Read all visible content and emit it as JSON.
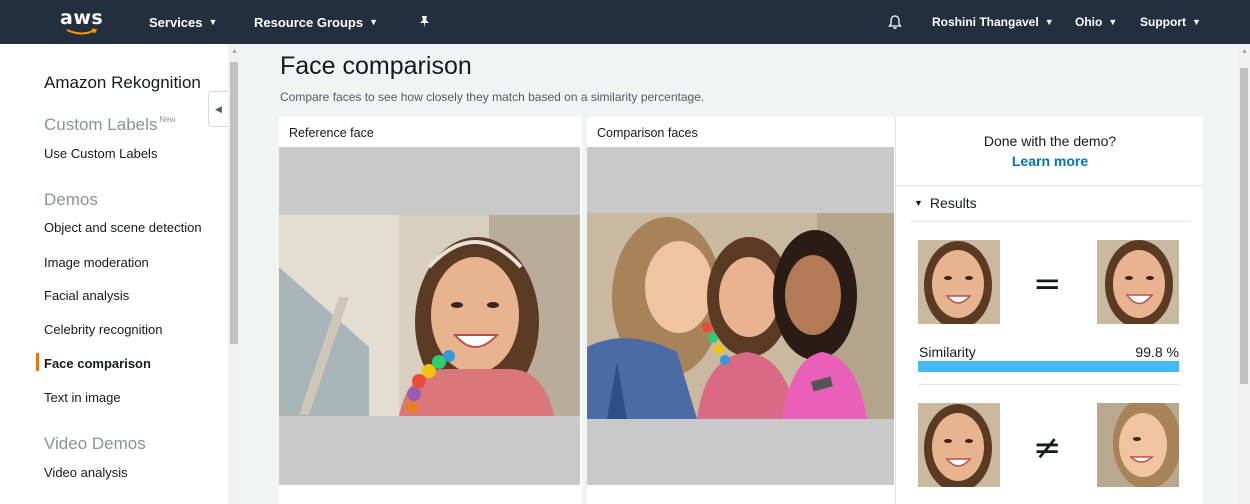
{
  "nav": {
    "logo": "aws",
    "services": "Services",
    "resource_groups": "Resource Groups",
    "user": "Roshini Thangavel",
    "region": "Ohio",
    "support": "Support"
  },
  "sidebar": {
    "title": "Amazon Rekognition",
    "custom_labels_heading": "Custom Labels",
    "custom_labels_badge": "New",
    "use_custom_labels": "Use Custom Labels",
    "demos_heading": "Demos",
    "demos": [
      "Object and scene detection",
      "Image moderation",
      "Facial analysis",
      "Celebrity recognition",
      "Face comparison",
      "Text in image"
    ],
    "active_item": "Face comparison",
    "video_demos_heading": "Video Demos",
    "video_analysis": "Video analysis"
  },
  "main": {
    "title": "Face comparison",
    "description": "Compare faces to see how closely they match based on a similarity percentage.",
    "reference_label": "Reference face",
    "comparison_label": "Comparison faces"
  },
  "results": {
    "done_text": "Done with the demo?",
    "learn_more": "Learn more",
    "heading": "Results",
    "match_symbol": "=",
    "nomatch_symbol": "≠",
    "similarity_label": "Similarity",
    "similarity_value": "99.8 %",
    "similarity_fraction": 0.998
  },
  "colors": {
    "nav_bg": "#232f3e",
    "accent": "#ec7211",
    "link": "#0073bb",
    "similarity_bar": "#44b9f3"
  }
}
